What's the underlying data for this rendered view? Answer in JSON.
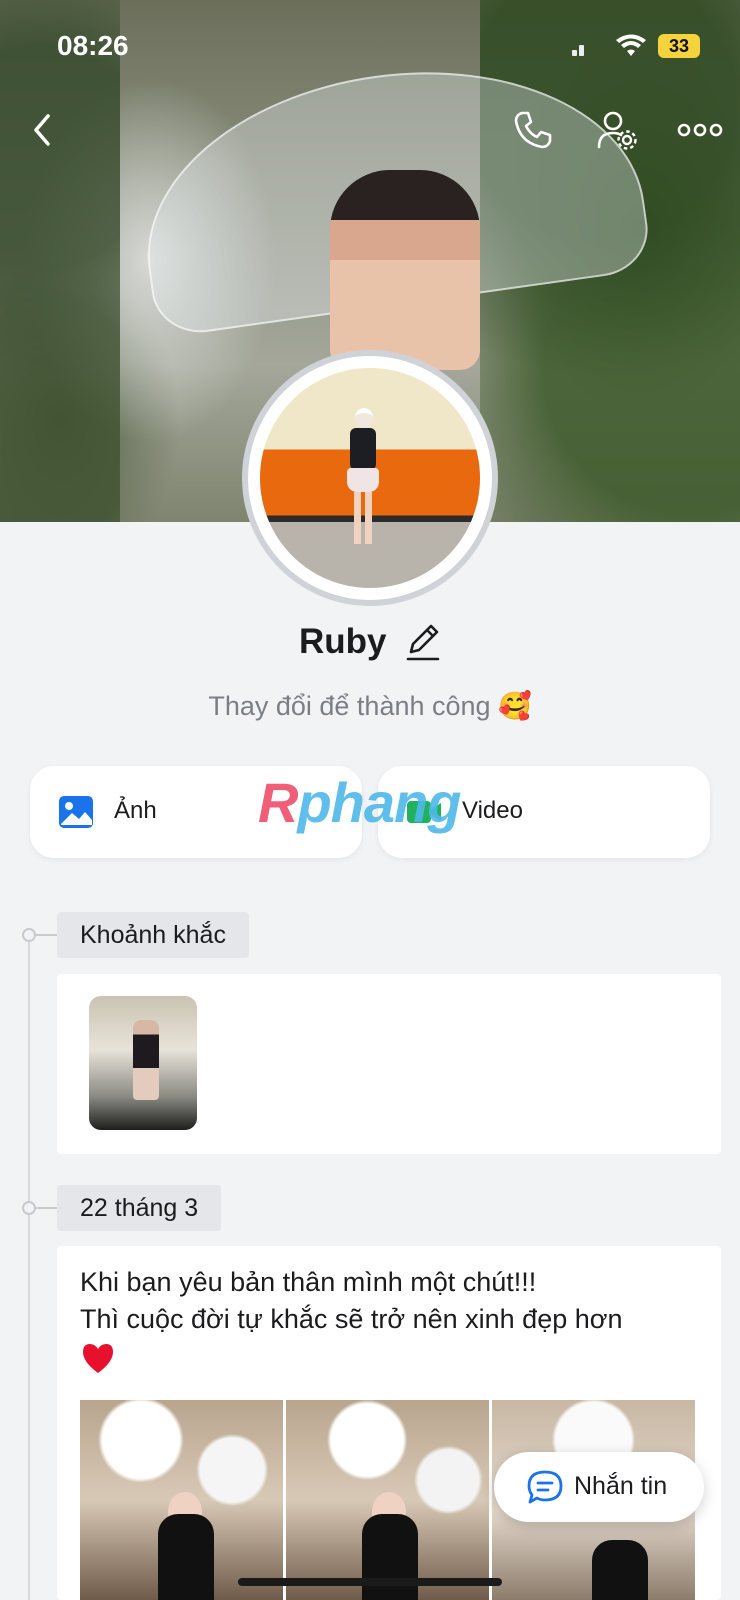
{
  "status_bar": {
    "time": "08:26",
    "battery": "33"
  },
  "profile": {
    "name": "Ruby",
    "bio": "Thay đổi để thành công 🥰"
  },
  "actions": {
    "photo_label": "Ảnh",
    "video_label": "Video"
  },
  "watermark": {
    "text_a": "R",
    "text_b": "phang"
  },
  "timeline": {
    "moments_label": "Khoảnh khắc",
    "post_date_label": "22 tháng 3",
    "post_text_line1": "Khi bạn yêu bản thân mình một chút!!!",
    "post_text_line2": "Thì cuộc đời tự khắc sẽ trở nên xinh đẹp hơn"
  },
  "chat_button": {
    "label": "Nhắn tin"
  },
  "colors": {
    "accent": "#1a73e8",
    "tag_bg": "#e4e6e9",
    "background": "#f2f3f5",
    "heart": "#e8112d"
  },
  "icons": [
    "back-icon",
    "phone-icon",
    "user-settings-icon",
    "more-icon",
    "edit-icon",
    "photo-icon",
    "video-icon",
    "heart-icon",
    "chat-icon"
  ]
}
